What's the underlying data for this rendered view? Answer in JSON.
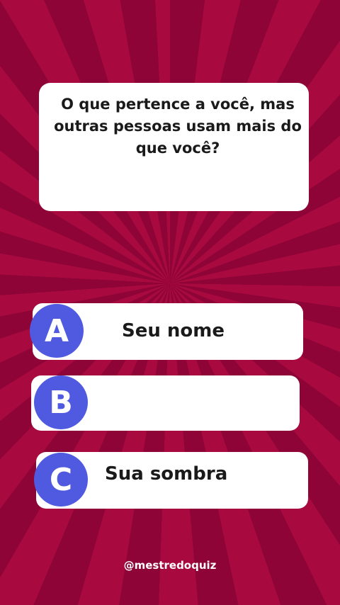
{
  "question": {
    "text": "O que pertence a você, mas outras pessoas usam mais do que você?"
  },
  "options": [
    {
      "letter": "A",
      "label": "Seu nome"
    },
    {
      "letter": "B",
      "label": ""
    },
    {
      "letter": "C",
      "label": "Sua sombra"
    }
  ],
  "footer": {
    "handle": "@mestredoquiz"
  },
  "colors": {
    "background_dark": "#8e0436",
    "background_light": "#a8093f",
    "badge": "#4f5ae0",
    "card": "#ffffff"
  }
}
